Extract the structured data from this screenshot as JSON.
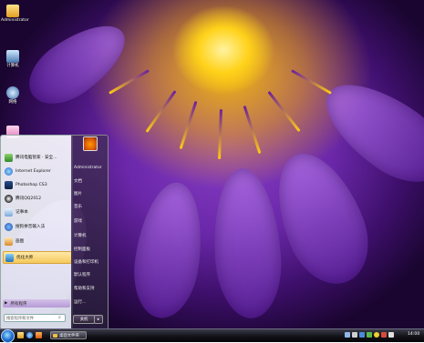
{
  "desktop": {
    "icons": [
      {
        "label": "Administrator"
      },
      {
        "label": "计算机"
      },
      {
        "label": "网络"
      },
      {
        "label": ""
      }
    ]
  },
  "start_menu": {
    "programs": [
      {
        "label": "腾讯电脑管家 · 安全..."
      },
      {
        "label": "Internet Explorer"
      },
      {
        "label": "Photoshop CS3"
      },
      {
        "label": "腾讯QQ2012"
      },
      {
        "label": "记事本"
      },
      {
        "label": "搜狗拼音输入法"
      },
      {
        "label": "画图"
      },
      {
        "label": "优化大师"
      }
    ],
    "all_programs_label": "所有程序",
    "search": {
      "placeholder": "搜索程序和文件"
    },
    "user_name": "Administrator",
    "right_links": [
      "文档",
      "图片",
      "音乐",
      "游戏",
      "计算机",
      "控制面板",
      "设备和打印机",
      "默认程序",
      "帮助和支持",
      "运行..."
    ],
    "shutdown_label": "关机",
    "shutdown_arrow": "▸"
  },
  "taskbar": {
    "task_button_label": "桌面文件夹",
    "clock": "14:00"
  },
  "colors": {
    "highlight": "#f5c85a",
    "taskbar": "#121218"
  }
}
